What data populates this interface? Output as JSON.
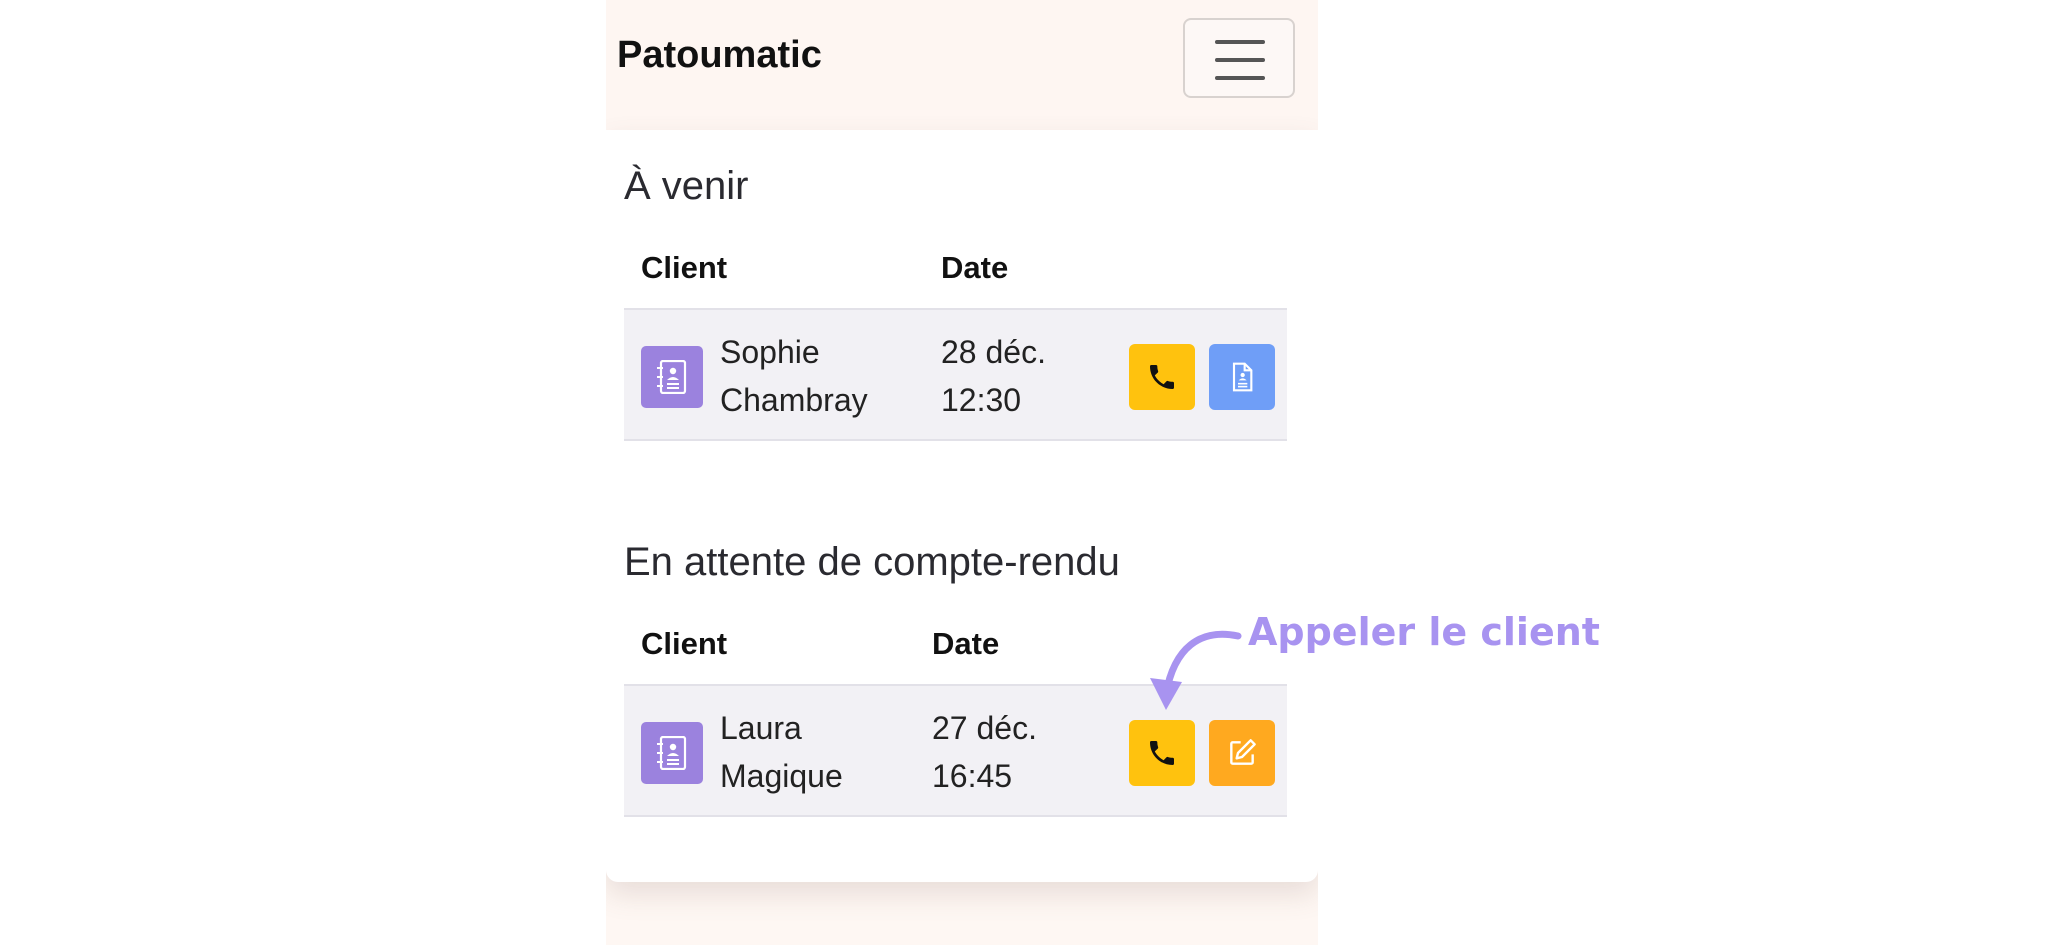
{
  "app": {
    "brand": "Patoumatic"
  },
  "sections": [
    {
      "title": "À venir",
      "headers": {
        "client": "Client",
        "date": "Date"
      },
      "rows": [
        {
          "first_name": "Sophie",
          "last_name": "Chambray",
          "date": "28 déc.",
          "time": "12:30",
          "actions": [
            "call-icon",
            "document-icon"
          ]
        }
      ]
    },
    {
      "title": "En attente de compte-rendu",
      "headers": {
        "client": "Client",
        "date": "Date"
      },
      "rows": [
        {
          "first_name": "Laura",
          "last_name": "Magique",
          "date": "27 déc.",
          "time": "16:45",
          "actions": [
            "call-icon",
            "edit-icon"
          ]
        }
      ]
    }
  ],
  "annotation": {
    "text": "Appeler le client"
  },
  "colors": {
    "contact_icon": "#9b82de",
    "call_button": "#ffc20e",
    "document_button": "#6f9ef7",
    "edit_button": "#ffa91f",
    "annotation": "#a893f0"
  }
}
